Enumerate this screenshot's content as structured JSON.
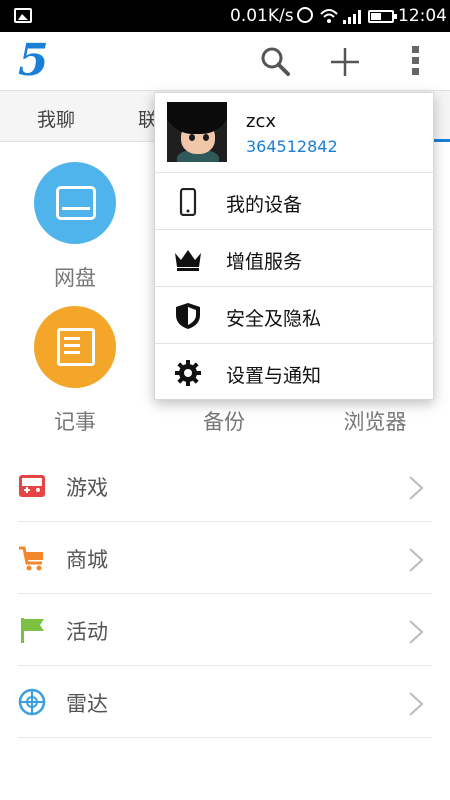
{
  "status_bar": {
    "network_speed": "0.01K/s",
    "time": "12:04"
  },
  "app": {
    "logo_text": "5",
    "accent_color": "#1a7fd6"
  },
  "tabs": [
    {
      "label": "我聊"
    },
    {
      "label": "联"
    }
  ],
  "grid": [
    {
      "label": "网盘",
      "icon": "hard-drive-icon",
      "color": "#4fb3ec"
    },
    {
      "label": "记事",
      "icon": "notepad-icon",
      "color": "#f4a62b"
    },
    {
      "label": "备份",
      "icon": "backup-icon"
    },
    {
      "label": "浏览器",
      "icon": "browser-icon"
    }
  ],
  "list": [
    {
      "label": "游戏",
      "icon": "gamepad-icon",
      "color": "#e64545"
    },
    {
      "label": "商城",
      "icon": "shopping-cart-icon",
      "color": "#f2872b"
    },
    {
      "label": "活动",
      "icon": "flag-icon",
      "color": "#7cc142"
    },
    {
      "label": "雷达",
      "icon": "radar-icon",
      "color": "#3a9fe0"
    }
  ],
  "menu": {
    "profile": {
      "name": "zcx",
      "id": "364512842"
    },
    "items": [
      {
        "label": "我的设备",
        "icon": "phone-icon"
      },
      {
        "label": "增值服务",
        "icon": "crown-icon"
      },
      {
        "label": "安全及隐私",
        "icon": "shield-icon"
      },
      {
        "label": "设置与通知",
        "icon": "gear-icon"
      }
    ]
  }
}
